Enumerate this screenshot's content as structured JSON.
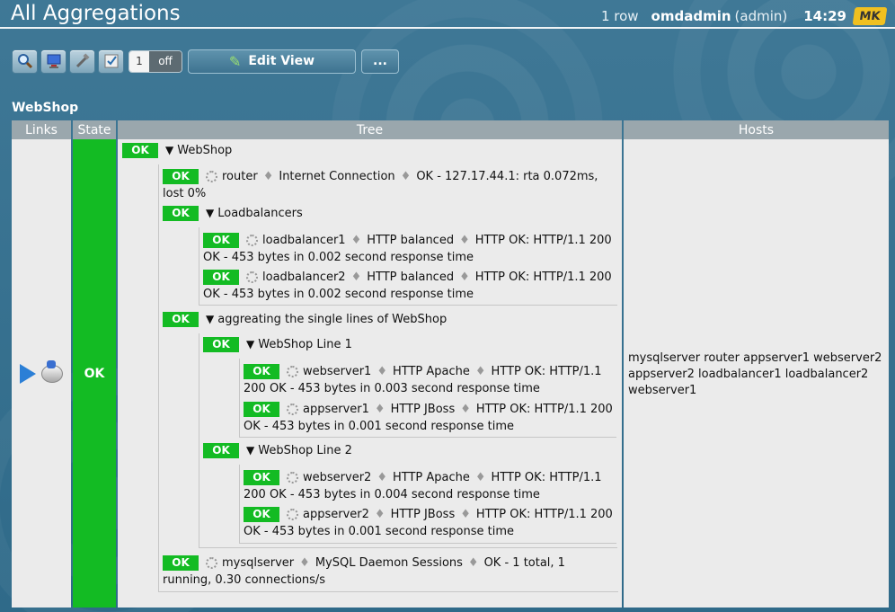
{
  "header": {
    "title": "All Aggregations",
    "row_count": "1 row",
    "user": "omdadmin",
    "role": "(admin)",
    "time": "14:29",
    "logo": "MK"
  },
  "toolbar": {
    "buttons": [
      {
        "name": "search-icon"
      },
      {
        "name": "display-icon"
      },
      {
        "name": "tools-icon"
      },
      {
        "name": "checkbox-icon"
      }
    ],
    "toggle_number": "1",
    "toggle_state": "off",
    "edit_view_label": "Edit View",
    "more_label": "..."
  },
  "group": {
    "title": "WebShop"
  },
  "table": {
    "headers": {
      "links": "Links",
      "state": "State",
      "tree": "Tree",
      "hosts": "Hosts"
    },
    "state": "OK",
    "hosts": "mysqlserver router appserver1 webserver2 appserver2 loadbalancer1 loadbalancer2 webserver1"
  },
  "tree": {
    "root": {
      "state": "OK",
      "label": "WebShop"
    },
    "router": {
      "state": "OK",
      "host": "router",
      "service": "Internet Connection",
      "output": "OK - 127.17.44.1: rta 0.072ms, lost 0%"
    },
    "loadbalancers": {
      "state": "OK",
      "label": "Loadbalancers"
    },
    "lb1": {
      "state": "OK",
      "host": "loadbalancer1",
      "service": "HTTP balanced",
      "output": "HTTP OK: HTTP/1.1 200 OK - 453 bytes in 0.002 second response time"
    },
    "lb2": {
      "state": "OK",
      "host": "loadbalancer2",
      "service": "HTTP balanced",
      "output": "HTTP OK: HTTP/1.1 200 OK - 453 bytes in 0.002 second response time"
    },
    "aggregating": {
      "state": "OK",
      "label": "aggreating the single lines of WebShop"
    },
    "line1": {
      "state": "OK",
      "label": "WebShop Line 1"
    },
    "ws1": {
      "state": "OK",
      "host": "webserver1",
      "service": "HTTP Apache",
      "output": "HTTP OK: HTTP/1.1 200 OK - 453 bytes in 0.003 second response time"
    },
    "as1": {
      "state": "OK",
      "host": "appserver1",
      "service": "HTTP JBoss",
      "output": "HTTP OK: HTTP/1.1 200 OK - 453 bytes in 0.001 second response time"
    },
    "line2": {
      "state": "OK",
      "label": "WebShop Line 2"
    },
    "ws2": {
      "state": "OK",
      "host": "webserver2",
      "service": "HTTP Apache",
      "output": "HTTP OK: HTTP/1.1 200 OK - 453 bytes in 0.004 second response time"
    },
    "as2": {
      "state": "OK",
      "host": "appserver2",
      "service": "HTTP JBoss",
      "output": "HTTP OK: HTTP/1.1 200 OK - 453 bytes in 0.001 second response time"
    },
    "mysql": {
      "state": "OK",
      "host": "mysqlserver",
      "service": "MySQL Daemon Sessions",
      "output": "OK - 1 total, 1 running, 0.30 connections/s"
    }
  },
  "colors": {
    "ok_green": "#13bb23",
    "header_gray": "#9aa7ad",
    "background": "#3a7393"
  }
}
